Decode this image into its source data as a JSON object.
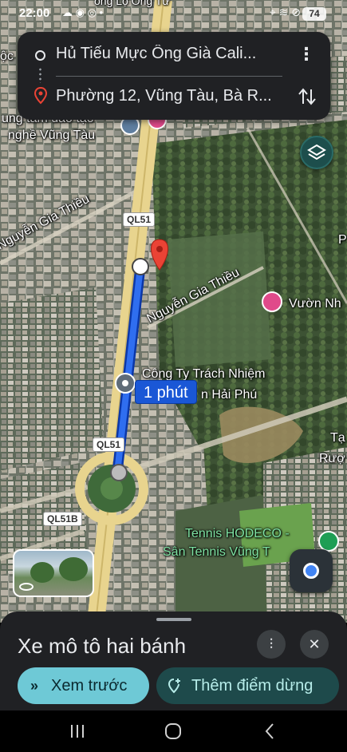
{
  "status_bar": {
    "time": "22:00",
    "left_icons": "☁ ◉ ◎ •",
    "right_icons": "⌖ ≋ ⊘",
    "battery": "74"
  },
  "route": {
    "origin": "Hủ Tiếu Mực Ông Già Cali...",
    "destination": "Phường 12, Vũng Tàu, Bà R...",
    "more_icon": "⋮"
  },
  "map": {
    "labels": {
      "top_road": "ông Lộ Ông Tư",
      "left_edge": "ộc",
      "training_line1": "ung tâm đào tạo",
      "training_line2": "nghề Vũng Tàu",
      "nguyen_gia_thieu_1": "Nguyễn Gia Thiều",
      "nguyen_gia_thieu_2": "Nguyễn Gia Thiều",
      "vuon_nh": "Vườn Nh",
      "company_line1": "Công Ty Trách Nhiệm",
      "company_line2": "n Hải Phú",
      "right_edge_1": "Tạ",
      "right_edge_2": "Rượ",
      "tennis_line1": "Tennis HODECO -",
      "tennis_line2": "Sân Tennis Vũng T",
      "right_edge_top": "P"
    },
    "shields": {
      "ql51_a": "QL51",
      "ql51_b": "QL51",
      "ql51b": "QL51B"
    },
    "duration": "1 phút"
  },
  "bottom_sheet": {
    "travel_mode": "Xe mô tô hai bánh",
    "preview_label": "Xem trước",
    "add_stop_label": "Thêm điểm dừng",
    "preview_icon": "»",
    "settings_icon": "⫶",
    "close_icon": "✕"
  },
  "nav_bar": {
    "recents": "|||",
    "home": "○",
    "back": "‹"
  },
  "colors": {
    "route_blue": "#1a57d6",
    "preview_button": "#6ec9d6",
    "add_stop_button": "#1e4a4b",
    "destination_pin": "#ea4335",
    "sheet_background": "#202124"
  }
}
